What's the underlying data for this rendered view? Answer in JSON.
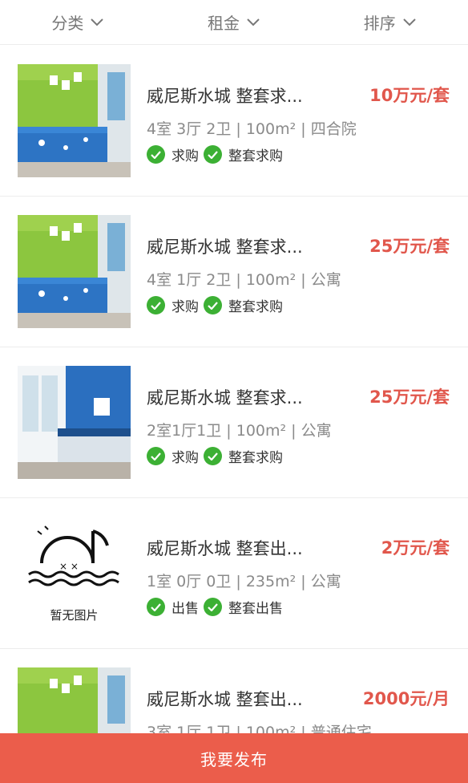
{
  "filters": [
    {
      "label": "分类",
      "icon": "chevron-down-icon"
    },
    {
      "label": "租金",
      "icon": "chevron-down-icon"
    },
    {
      "label": "排序",
      "icon": "chevron-down-icon"
    }
  ],
  "listings": [
    {
      "title": "威尼斯水城 整套求...",
      "price": "10万元/套",
      "meta": "4室 3厅 2卫 | 100m² | 四合院",
      "tags": [
        "求购",
        "整套求购"
      ],
      "image": "green-bedroom"
    },
    {
      "title": "威尼斯水城 整套求...",
      "price": "25万元/套",
      "meta": "4室 1厅 2卫 | 100m² | 公寓",
      "tags": [
        "求购",
        "整套求购"
      ],
      "image": "green-bedroom"
    },
    {
      "title": "威尼斯水城 整套求...",
      "price": "25万元/套",
      "meta": "2室1厅1卫 | 100m² | 公寓",
      "tags": [
        "求购",
        "整套求购"
      ],
      "image": "blue-bedroom"
    },
    {
      "title": "威尼斯水城 整套出...",
      "price": "2万元/套",
      "meta": "1室 0厅 0卫 | 235m² | 公寓",
      "tags": [
        "出售",
        "整套出售"
      ],
      "image": "no-image",
      "no_image_label": "暂无图片"
    },
    {
      "title": "威尼斯水城 整套出...",
      "price": "2000元/月",
      "meta": "3室 1厅 1卫 | 100m² | 普通住宅",
      "tags": [],
      "image": "green-bedroom"
    }
  ],
  "publish_button": "我要发布",
  "colors": {
    "price": "#e1574c",
    "check": "#3cb034",
    "publish": "#eb5d4b"
  }
}
